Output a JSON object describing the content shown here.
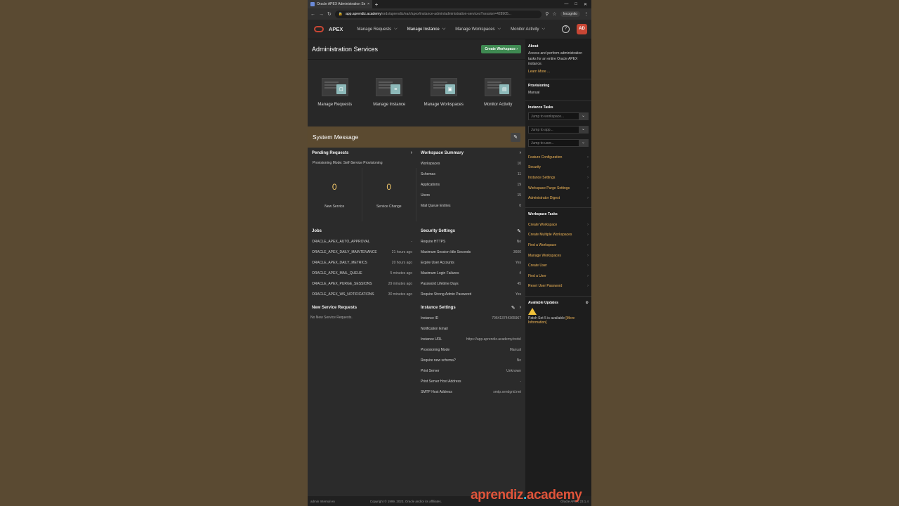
{
  "browser": {
    "tab_title": "Oracle APEX Administration Se",
    "new_tab": "+",
    "url_host": "app.aprendiz.academy",
    "url_path": "/ords/aprendiz/ea/r/apex/instance-admin/administration-services?session=428905...",
    "incognito": "Incognito",
    "controls": [
      "—",
      "□",
      "✕"
    ]
  },
  "header": {
    "product": "APEX",
    "menu": [
      "Manage Requests",
      "Manage Instance",
      "Manage Workspaces",
      "Monitor Activity"
    ],
    "help": "?",
    "avatar": "AD"
  },
  "page": {
    "title": "Administration Services",
    "create_button": "Create Workspace ›",
    "cards": [
      "Manage Requests",
      "Manage Instance",
      "Manage Workspaces",
      "Monitor Activity"
    ],
    "system_message": "System Message"
  },
  "pending": {
    "title": "Pending Requests",
    "mode": "Provisioning Mode: Self-Service Provisioning",
    "new_service_count": "0",
    "new_service_label": "New Service",
    "service_change_count": "0",
    "service_change_label": "Service Change"
  },
  "workspace_summary": {
    "title": "Workspace Summary",
    "rows": [
      {
        "label": "Workspaces",
        "value": "10"
      },
      {
        "label": "Schemas",
        "value": "11"
      },
      {
        "label": "Applications",
        "value": "19"
      },
      {
        "label": "Users",
        "value": "15"
      },
      {
        "label": "Mail Queue Entries",
        "value": "0"
      }
    ]
  },
  "jobs": {
    "title": "Jobs",
    "rows": [
      {
        "label": "ORACLE_APEX_AUTO_APPROVAL",
        "value": "-"
      },
      {
        "label": "ORACLE_APEX_DAILY_MAINTENANCE",
        "value": "21 hours ago"
      },
      {
        "label": "ORACLE_APEX_DAILY_METRICS",
        "value": "20 hours ago"
      },
      {
        "label": "ORACLE_APEX_MAIL_QUEUE",
        "value": "5 minutes ago"
      },
      {
        "label": "ORACLE_APEX_PURGE_SESSIONS",
        "value": "29 minutes ago"
      },
      {
        "label": "ORACLE_APEX_WS_NOTIFICATIONS",
        "value": "30 minutes ago"
      }
    ]
  },
  "security": {
    "title": "Security Settings",
    "rows": [
      {
        "label": "Require HTTPS",
        "value": "No"
      },
      {
        "label": "Maximum Session Idle Seconds",
        "value": "3600"
      },
      {
        "label": "Expire User Accounts",
        "value": "Yes"
      },
      {
        "label": "Maximum Login Failures",
        "value": "4"
      },
      {
        "label": "Password Lifetime Days",
        "value": "45"
      },
      {
        "label": "Require Strong Admin Password",
        "value": "Yes"
      }
    ]
  },
  "new_service": {
    "title": "New Service Requests",
    "empty": "No New Service Requests."
  },
  "instance": {
    "title": "Instance Settings",
    "rows": [
      {
        "label": "Instance ID",
        "value": "706413744365967"
      },
      {
        "label": "Notification Email",
        "value": ""
      },
      {
        "label": "Instance URL",
        "value": "https://app.aprendiz.academy/ords/"
      },
      {
        "label": "Provisioning Mode",
        "value": "Manual"
      },
      {
        "label": "Require new schema?",
        "value": "No"
      },
      {
        "label": "Print Server",
        "value": "Unknown"
      },
      {
        "label": "Print Server Host Address",
        "value": "-"
      },
      {
        "label": "SMTP Host Address",
        "value": "smtp.sendgrid.net"
      }
    ]
  },
  "sidebar": {
    "about_title": "About",
    "about_text": "Access and perform administration tasks for an entire Oracle APEX instance.",
    "learn_more": "Learn More ...",
    "provisioning_title": "Provisioning",
    "provisioning_value": "Manual",
    "instance_tasks_title": "Instance Tasks",
    "jump_workspace": "Jump to workspace...",
    "jump_app": "Jump to app...",
    "jump_user": "Jump to user...",
    "instance_tasks": [
      "Feature Configuration",
      "Security",
      "Instance Settings",
      "Workspace Purge Settings",
      "Administrator Digest"
    ],
    "workspace_tasks_title": "Workspace Tasks",
    "workspace_tasks": [
      "Create Workspace",
      "Create Multiple Workspaces",
      "Find a Workspace",
      "Manage Workspaces",
      "Create User",
      "Find a User",
      "Reset User Password"
    ],
    "updates_title": "Available Updates",
    "updates_text": "Patch Set 5 is available",
    "updates_link": "[More Information]"
  },
  "footer": {
    "left": "admin   Internal   en",
    "copyright": "Copyright © 1999, 2023, Oracle and/or its affiliates.",
    "version": "Oracle APEX 23.1.4"
  },
  "watermark": {
    "left": "aprendiz",
    "dot": ".",
    "right": "academy"
  },
  "colors": {
    "accent": "#c74634",
    "link": "#f0b556",
    "create": "#3f8a52",
    "system_message_bg": "#5b4a30"
  }
}
